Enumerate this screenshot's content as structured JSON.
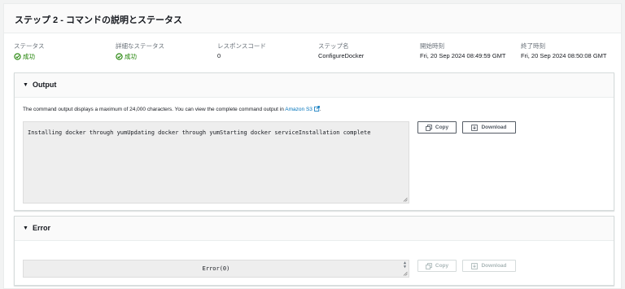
{
  "header": {
    "title": "ステップ 2 - コマンドの説明とステータス"
  },
  "stats": [
    {
      "label": "ステータス",
      "value": "成功",
      "ok": true
    },
    {
      "label": "詳細なステータス",
      "value": "成功",
      "ok": true
    },
    {
      "label": "レスポンスコード",
      "value": "0",
      "ok": false
    },
    {
      "label": "ステップ名",
      "value": "ConfigureDocker",
      "ok": false
    },
    {
      "label": "開始時刻",
      "value": "Fri, 20 Sep 2024 08:49:59 GMT",
      "ok": false
    },
    {
      "label": "終了時刻",
      "value": "Fri, 20 Sep 2024 08:50:08 GMT",
      "ok": false
    }
  ],
  "output": {
    "title": "Output",
    "notice_text": "The command output displays a maximum of 24,000 characters. You can view the complete command output in ",
    "notice_link": "Amazon S3",
    "notice_end": ".",
    "content": "Installing docker through yumUpdating docker through yumStarting docker serviceInstallation complete",
    "copy_label": "Copy",
    "download_label": "Download"
  },
  "error": {
    "title": "Error",
    "content": "Error(0)",
    "copy_label": "Copy",
    "download_label": "Download"
  },
  "colors": {
    "success": "#1d8102",
    "link": "#0073bb"
  },
  "icons": [
    "check-circle-icon",
    "caret-down-icon",
    "external-link-icon",
    "copy-icon",
    "download-icon"
  ]
}
